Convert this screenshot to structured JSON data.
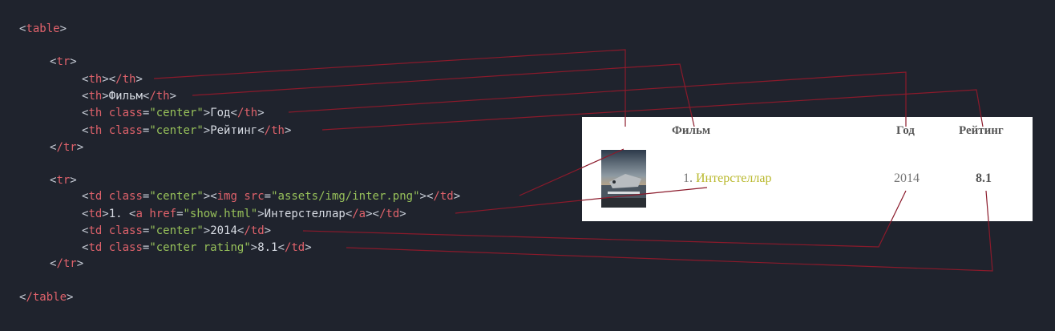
{
  "code": {
    "table_open": "table",
    "table_close": "/table",
    "tr_open": "tr",
    "tr_close": "/tr",
    "th": "th",
    "th_close": "/th",
    "td": "td",
    "td_close": "/td",
    "img_tag": "img",
    "a_tag": "a",
    "a_close": "/a",
    "attr_class": "class",
    "attr_src": "src",
    "attr_href": "href",
    "val_center": "\"center\"",
    "val_center_rating": "\"center rating\"",
    "val_src": "\"assets/img/inter.png\"",
    "val_href": "\"show.html\"",
    "text_film": "Фильм",
    "text_year": "Год",
    "text_rating": "Рейтинг",
    "text_num": "1. ",
    "text_title": "Интерстеллар",
    "text_year_val": "2014",
    "text_rating_val": "8.1"
  },
  "preview": {
    "headers": [
      "",
      "Фильм",
      "Год",
      "Рейтинг"
    ],
    "row": {
      "num": "1. ",
      "title": "Интерстеллар",
      "year": "2014",
      "rating": "8.1"
    }
  },
  "colors": {
    "background": "#1f232d",
    "tag": "#e0626b",
    "string": "#97c15a",
    "link": "#b9b82c",
    "connector": "#8b1a2b"
  }
}
